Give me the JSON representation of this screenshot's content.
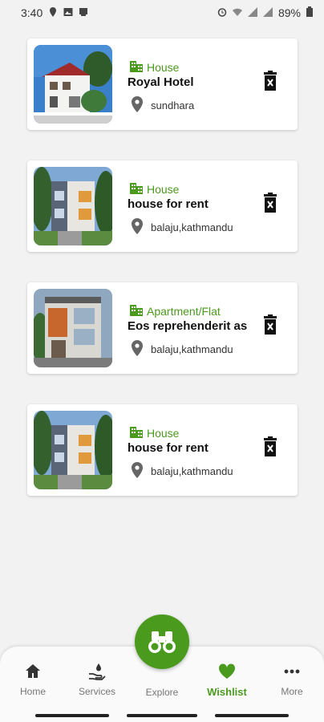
{
  "status_bar": {
    "time": "3:40",
    "battery": "89%"
  },
  "colors": {
    "accent": "#4a9a1d",
    "background": "#f2f2f2"
  },
  "wishlist": [
    {
      "category": "House",
      "title": "Royal Hotel",
      "location": "sundhara",
      "image": "white-villa-photo"
    },
    {
      "category": "House",
      "title": "house for rent",
      "location": "balaju,kathmandu",
      "image": "modern-house-photo"
    },
    {
      "category": "Apartment/Flat",
      "title": "Eos reprehenderit as",
      "location": "balaju,kathmandu",
      "image": "orange-apartment-photo"
    },
    {
      "category": "House",
      "title": "house for rent",
      "location": "balaju,kathmandu",
      "image": "modern-house-photo"
    }
  ],
  "bottom_nav": {
    "home": "Home",
    "services": "Services",
    "explore": "Explore",
    "wishlist": "Wishlist",
    "more": "More"
  }
}
